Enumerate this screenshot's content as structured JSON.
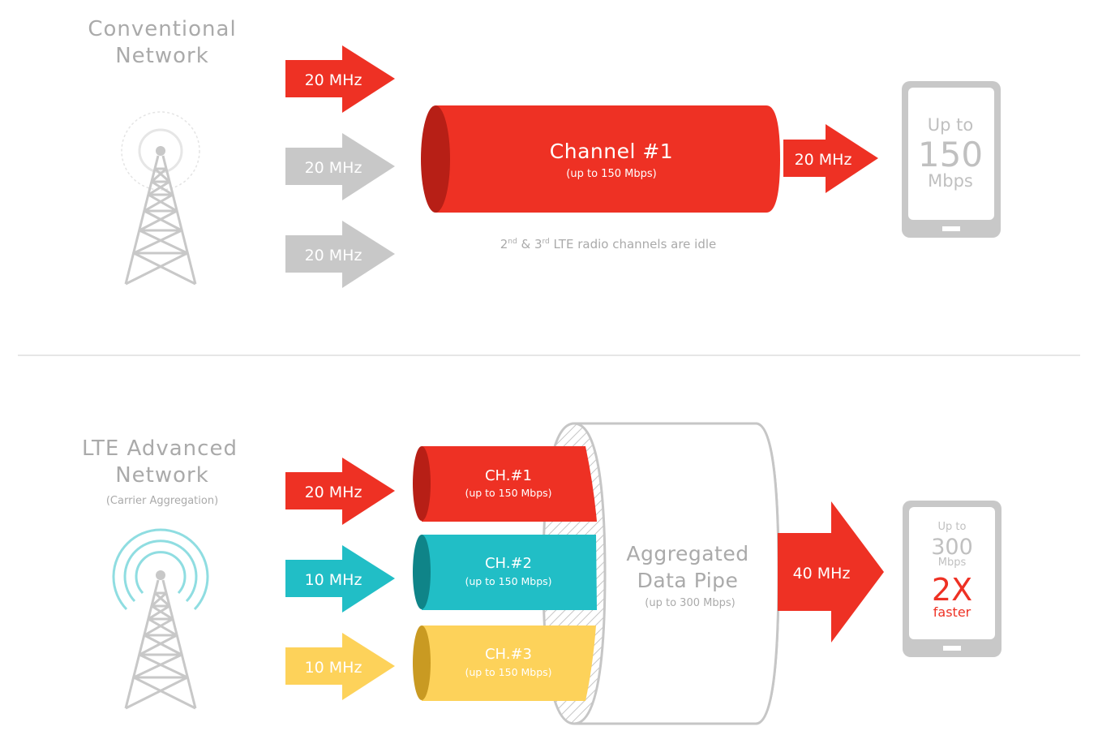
{
  "colors": {
    "red": "#ee3124",
    "red_dark": "#b71f16",
    "grey": "#c8c8c8",
    "grey_text": "#aaaaaa",
    "teal": "#21bec6",
    "teal_dark": "#0f8488",
    "yellow": "#fdd25a",
    "yellow_dark": "#c99a22",
    "ring_teal": "#8fdde1",
    "ring_grey": "#e4e4e4"
  },
  "conventional": {
    "title_line1": "Conventional",
    "title_line2": "Network",
    "inputs": [
      {
        "label": "20 MHz",
        "state": "active"
      },
      {
        "label": "20 MHz",
        "state": "idle"
      },
      {
        "label": "20 MHz",
        "state": "idle"
      }
    ],
    "channel": {
      "title": "Channel #1",
      "subtitle": "(up to 150 Mbps)"
    },
    "idle_note": {
      "ord1": "2",
      "sup1": "nd",
      "amp": " & ",
      "ord2": "3",
      "sup2": "rd",
      "rest": " LTE radio channels are idle"
    },
    "output": "20 MHz",
    "device": {
      "line1": "Up to",
      "line2": "150",
      "line3": "Mbps"
    }
  },
  "advanced": {
    "title_line1": "LTE Advanced",
    "title_line2": "Network",
    "subtitle": "(Carrier Aggregation)",
    "inputs": [
      {
        "label": "20 MHz",
        "color": "red"
      },
      {
        "label": "10 MHz",
        "color": "teal"
      },
      {
        "label": "10 MHz",
        "color": "yellow"
      }
    ],
    "channels": [
      {
        "title": "CH.#1",
        "subtitle": "(up to 150 Mbps)"
      },
      {
        "title": "CH.#2",
        "subtitle": "(up to 150 Mbps)"
      },
      {
        "title": "CH.#3",
        "subtitle": "(up to 150 Mbps)"
      }
    ],
    "pipe": {
      "line1": "Aggregated",
      "line2": "Data Pipe",
      "subtitle": "(up to 300 Mbps)"
    },
    "output": "40 MHz",
    "device": {
      "line1": "Up to",
      "line2": "300",
      "line3": "Mbps",
      "line4": "2X",
      "line5": "faster"
    }
  }
}
